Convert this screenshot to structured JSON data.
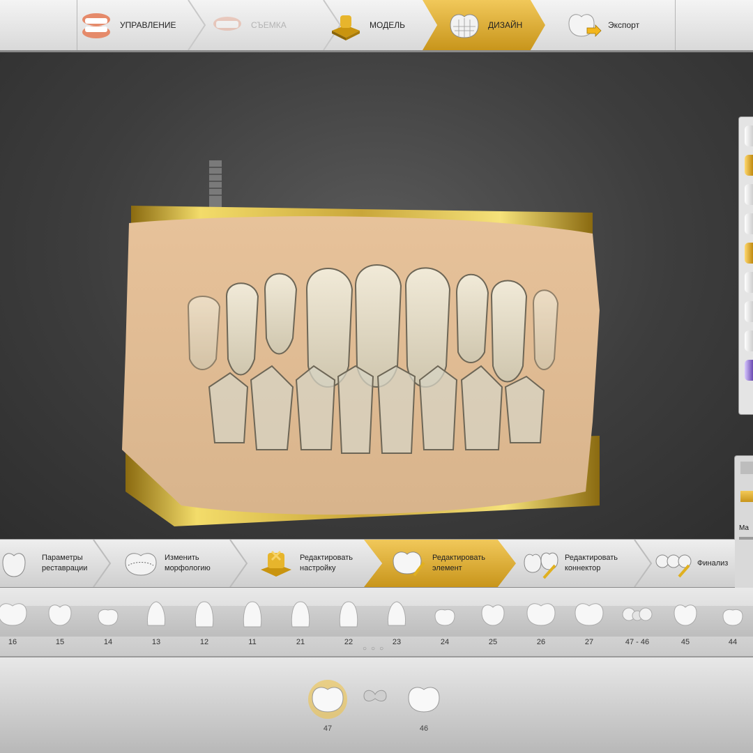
{
  "workflow": {
    "steps": [
      {
        "label": "УПРАВЛЕНИЕ",
        "icon": "dental-arch-icon",
        "state": "normal"
      },
      {
        "label": "СЪЕМКА",
        "icon": "scan-arch-icon",
        "state": "disabled"
      },
      {
        "label": "МОДЕЛЬ",
        "icon": "gold-model-icon",
        "state": "normal"
      },
      {
        "label": "ДИЗАЙН",
        "icon": "mesh-tooth-icon",
        "state": "active"
      },
      {
        "label": "Экспорт",
        "icon": "export-tooth-icon",
        "state": "normal"
      }
    ]
  },
  "design_tools": {
    "steps": [
      {
        "label": "Параметры\nреставрации",
        "icon": "restoration-params-icon",
        "state": "normal"
      },
      {
        "label": "Изменить\nморфологию",
        "icon": "morphology-icon",
        "state": "normal"
      },
      {
        "label": "Редактировать\nнастройку",
        "icon": "gold-setup-icon",
        "state": "normal"
      },
      {
        "label": "Редактировать\nэлемент",
        "icon": "edit-element-icon",
        "state": "active"
      },
      {
        "label": "Редактировать\nконнектор",
        "icon": "edit-connector-icon",
        "state": "normal"
      },
      {
        "label": "Финализ",
        "icon": "finalize-icon",
        "state": "normal"
      }
    ]
  },
  "side_panel": {
    "label": "Ma"
  },
  "teeth": [
    "16",
    "15",
    "14",
    "13",
    "12",
    "11",
    "21",
    "22",
    "23",
    "24",
    "25",
    "26",
    "27",
    "47 - 46",
    "45",
    "44"
  ],
  "selected_teeth": [
    {
      "number": "47",
      "selected": true
    },
    {
      "number": "46",
      "selected": false
    }
  ],
  "colors": {
    "accent_gold": "#d9a832",
    "active_gold_light": "#f1c85a",
    "active_gold_dark": "#c8951b"
  }
}
